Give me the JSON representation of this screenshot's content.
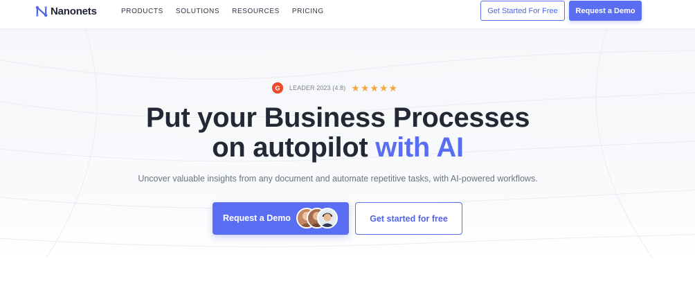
{
  "header": {
    "logo_text": "Nanonets",
    "nav": [
      "PRODUCTS",
      "SOLUTIONS",
      "RESOURCES",
      "PRICING"
    ],
    "cta_outline": "Get Started For Free",
    "cta_solid": "Request a Demo"
  },
  "hero": {
    "badge": {
      "icon": "g2-icon",
      "text": "LEADER 2023 (4.8)",
      "stars": 5
    },
    "headline_line1": "Put your Business Processes",
    "headline_line2_plain": "on autopilot",
    "headline_line2_accent": "with AI",
    "subtext": "Uncover valuable insights from any document and automate repetitive tasks, with AI-powered workflows.",
    "primary_button": "Request a Demo",
    "secondary_button": "Get started for free"
  },
  "colors": {
    "brand": "#5a6ef3",
    "star": "#f3a73f",
    "g2": "#ef4a2b",
    "text_dark": "#232834",
    "text_muted": "#6d7280"
  }
}
